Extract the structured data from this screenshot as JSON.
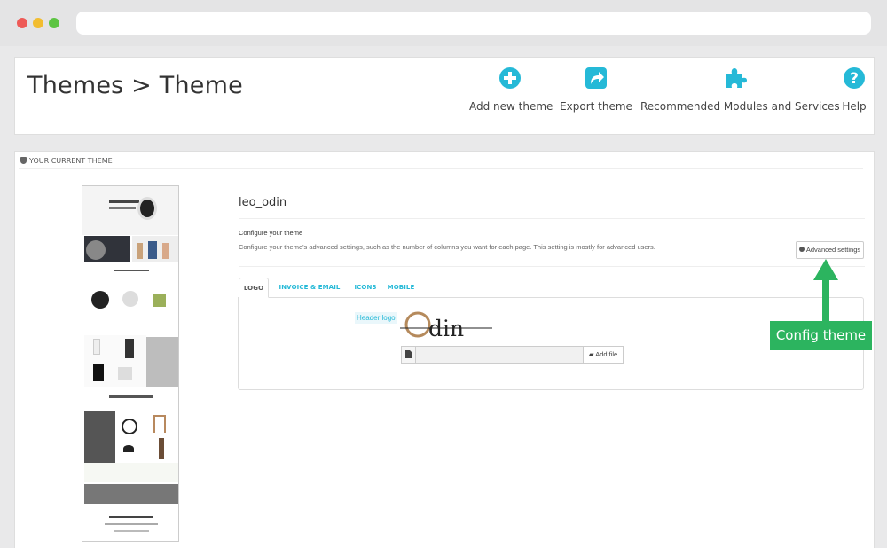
{
  "browser": {
    "dot_colors": [
      "#ee5a57",
      "#f2bd30",
      "#5cc442"
    ]
  },
  "header": {
    "title": "Themes > Theme",
    "toolbar": [
      {
        "label": "Add new theme",
        "icon": "plus-circle-icon"
      },
      {
        "label": "Export theme",
        "icon": "export-share-icon"
      },
      {
        "label": "Recommended Modules and Services",
        "icon": "puzzle-icon"
      },
      {
        "label": "Help",
        "icon": "help-circle-icon"
      }
    ],
    "accent": "#25b9d7"
  },
  "panel": {
    "heading": "YOUR CURRENT THEME"
  },
  "theme": {
    "name": "leo_odin",
    "configure_title": "Configure your theme",
    "configure_desc": "Configure your theme's advanced settings, such as the number of columns you want for each page. This setting is mostly for advanced users.",
    "advanced_button": "Advanced settings"
  },
  "tabs": [
    {
      "label": "LOGO",
      "active": true
    },
    {
      "label": "INVOICE & EMAIL LOGOS",
      "active": false
    },
    {
      "label": "ICONS",
      "active": false
    },
    {
      "label": "MOBILE",
      "active": false
    }
  ],
  "logo": {
    "label": "Header logo",
    "logo_text": "Odin",
    "add_file": "Add file"
  },
  "annotation": {
    "text": "Config theme",
    "color": "#2cb45f"
  }
}
